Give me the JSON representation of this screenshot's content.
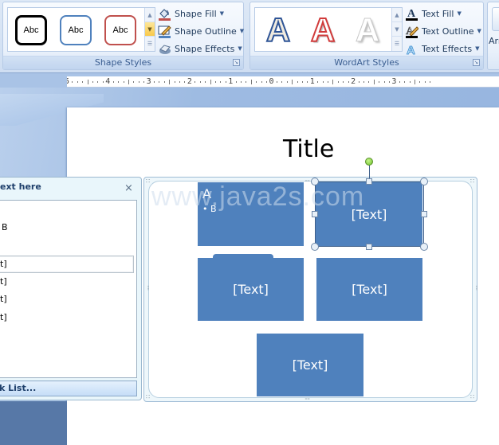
{
  "ribbon": {
    "shape_styles": {
      "label": "Shape Styles",
      "gallery": [
        {
          "text": "Abc",
          "border": "#000000"
        },
        {
          "text": "Abc",
          "border": "#4f81bd"
        },
        {
          "text": "Abc",
          "border": "#c0504d"
        }
      ],
      "commands": [
        {
          "label": "Shape Fill",
          "icon": "paint-bucket-icon"
        },
        {
          "label": "Shape Outline",
          "icon": "pencil-outline-icon"
        },
        {
          "label": "Shape Effects",
          "icon": "shape-effects-icon"
        }
      ]
    },
    "wordart_styles": {
      "label": "WordArt Styles",
      "gallery": [
        {
          "text": "A",
          "style": "blue-outline"
        },
        {
          "text": "A",
          "style": "red-outline"
        },
        {
          "text": "A",
          "style": "white-shadow"
        }
      ],
      "commands": [
        {
          "label": "Text Fill",
          "icon": "text-fill-icon"
        },
        {
          "label": "Text Outline",
          "icon": "text-outline-icon"
        },
        {
          "label": "Text Effects",
          "icon": "text-effects-icon"
        }
      ]
    },
    "arrange": {
      "label_partial": "Arr"
    }
  },
  "ruler": {
    "ticks": [
      "5",
      "4",
      "3",
      "2",
      "1",
      "0",
      "1",
      "2",
      "3"
    ]
  },
  "slide": {
    "title": "Title",
    "watermark": "www.java2s.com",
    "smartart": {
      "boxes": [
        {
          "heading": "A",
          "bullet": "B"
        },
        {
          "text": "[Text]",
          "selected": true
        },
        {
          "text": "[Text]"
        },
        {
          "text": "[Text]"
        },
        {
          "text": "[Text]"
        }
      ]
    }
  },
  "text_pane": {
    "title": "Type your text here",
    "title_visible": "ext here",
    "close": "×",
    "lines": [
      {
        "text": "B"
      },
      {
        "text": "t]"
      },
      {
        "text": "t]"
      },
      {
        "text": "t]"
      },
      {
        "text": "t]"
      }
    ],
    "footer_visible": "k List..."
  },
  "colors": {
    "smartart_fill": "#4f81bd",
    "ribbon_text": "#1e395b",
    "workspace": "#9ebbe2"
  }
}
